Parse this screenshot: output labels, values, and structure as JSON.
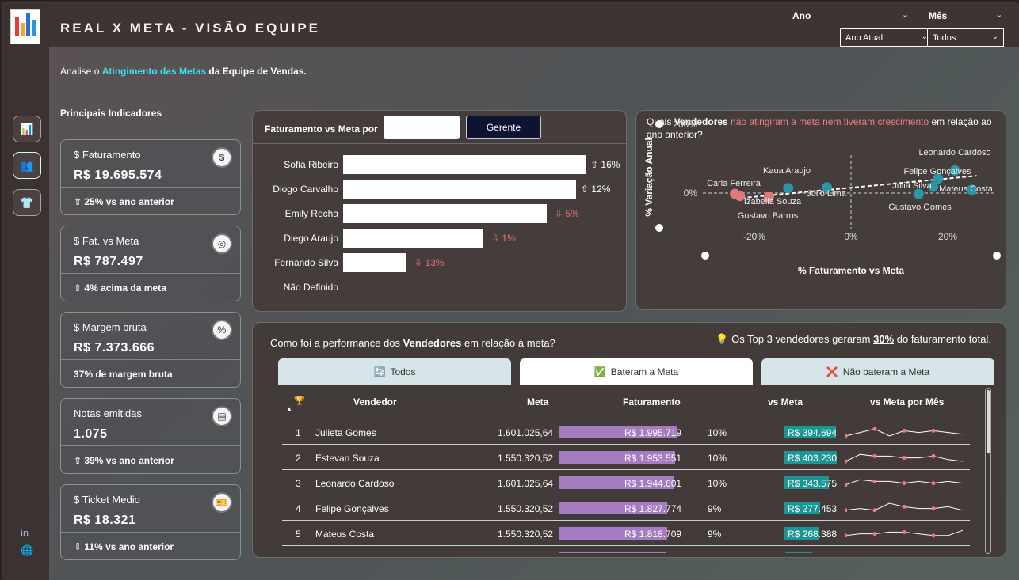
{
  "header": {
    "title": "REAL X META - VISÃO EQUIPE",
    "filters": [
      {
        "label": "Ano",
        "value": "Ano Atual"
      },
      {
        "label": "Mês",
        "value": "Todos"
      }
    ]
  },
  "intro": {
    "pre": "Analise o ",
    "highlight": "Atingimento das Metas",
    "post": " da Equipe de Vendas."
  },
  "kpi_section": {
    "title_pre": "Principais ",
    "title_bold": "Indicadores"
  },
  "kpis": [
    {
      "title": "$ Faturamento",
      "value": "R$ 19.695.574",
      "sub": "⇧ 25% vs ano anterior",
      "icon": "money-icon"
    },
    {
      "title": "$ Fat. vs Meta",
      "value": "R$ 787.497",
      "sub": "⇧ 4% acima da meta",
      "icon": "target-icon"
    },
    {
      "title": "$ Margem bruta",
      "value": "R$ 7.373.666",
      "sub": "37% de margem bruta",
      "icon": "percent-icon"
    },
    {
      "title": "Notas emitidas",
      "value": "1.075",
      "sub": "⇧ 39% vs ano anterior",
      "icon": "receipt-icon"
    },
    {
      "title": "$ Ticket Medio",
      "value": "R$ 18.321",
      "sub": "⇩ 11% vs ano anterior",
      "icon": "ticket-icon"
    }
  ],
  "bar_panel": {
    "title": "Faturamento vs Meta por",
    "toggle": "Gerente",
    "rows": [
      {
        "name": "Sofia Ribeiro",
        "value": 1.0,
        "pct": "⇧ 16%",
        "dir": "pos"
      },
      {
        "name": "Diogo Carvalho",
        "value": 0.96,
        "pct": "⇧ 12%",
        "dir": "pos"
      },
      {
        "name": "Emily Rocha",
        "value": 0.84,
        "pct": "⇩ 5%",
        "dir": "neg"
      },
      {
        "name": "Diego Araujo",
        "value": 0.58,
        "pct": "⇩ 1%",
        "dir": "neg"
      },
      {
        "name": "Fernando Silva",
        "value": 0.26,
        "pct": "⇩ 13%",
        "dir": "neg"
      },
      {
        "name": "Não Definido",
        "value": 0,
        "pct": "",
        "dir": "pos"
      }
    ]
  },
  "scatter": {
    "title_pre": "Quais ",
    "title_bold": "Vendedores",
    "title_red": " não atingiram a meta nem tiveram crescimento",
    "title_post": " em relação ao ano anterior?",
    "xlabel": "% Faturamento vs Meta",
    "ylabel": "% Variação Anual",
    "xticks": [
      {
        "v": -20,
        "t": "-20%"
      },
      {
        "v": 0,
        "t": "0%"
      },
      {
        "v": 20,
        "t": "20%"
      }
    ],
    "yticks": [
      {
        "v": 200,
        "t": "200%"
      },
      {
        "v": 0,
        "t": "0%"
      }
    ],
    "points": [
      {
        "name": "Leonardo Cardoso",
        "x": 21.5,
        "y": 55,
        "c": "#2a97a8"
      },
      {
        "name": "Felipe Gonçalves",
        "x": 18,
        "y": 35,
        "c": "#2a97a8"
      },
      {
        "name": "Kaua Araujo",
        "x": -13,
        "y": 12,
        "c": "#2a97a8"
      },
      {
        "name": "Julio Lima",
        "x": -5,
        "y": 14,
        "c": "#2a97a8"
      },
      {
        "name": "Julia Silva",
        "x": 17,
        "y": 15,
        "c": "#2a97a8"
      },
      {
        "name": "Mateus Costa",
        "x": 25,
        "y": 8,
        "c": "#2a97a8"
      },
      {
        "name": "Gustavo Gomes",
        "x": 14,
        "y": -2,
        "c": "#2a97a8"
      },
      {
        "name": "Carla Ferreira",
        "x": -24,
        "y": -2,
        "c": "#e07a7a"
      },
      {
        "name": "Izabella Souza",
        "x": -17,
        "y": -10,
        "c": "#e07a7a"
      },
      {
        "name": "Gustavo Barros",
        "x": -23,
        "y": -7,
        "c": "#e07a7a"
      }
    ]
  },
  "perf": {
    "title_pre": "Como foi a performance dos ",
    "title_bold": "Vendedores",
    "title_post": " em relação à meta?",
    "insight_pre": "💡 Os Top 3 vendedores geraram ",
    "insight_bold": "30%",
    "insight_post": " do faturamento total.",
    "tabs": [
      {
        "label": "Todos",
        "icon": "refresh-icon",
        "glyph": "🔄"
      },
      {
        "label": "Bateram a Meta",
        "icon": "check-icon",
        "glyph": "✅"
      },
      {
        "label": "Não bateram a Meta",
        "icon": "cross-icon",
        "glyph": "❌"
      }
    ],
    "columns": [
      "Vendedor",
      "Meta",
      "Faturamento",
      "vs Meta",
      "vs Meta por Mês"
    ],
    "rows": [
      {
        "rank": "1",
        "name": "Julieta Gomes",
        "meta": "1.601.025,64",
        "fat": "R$ 1.995.719",
        "fatv": 1995719,
        "pct": "10%",
        "vs": "R$ 394.694",
        "vsv": 394694
      },
      {
        "rank": "2",
        "name": "Estevan Souza",
        "meta": "1.550.320,52",
        "fat": "R$ 1.953.551",
        "fatv": 1953551,
        "pct": "10%",
        "vs": "R$ 403.230",
        "vsv": 403230
      },
      {
        "rank": "3",
        "name": "Leonardo Cardoso",
        "meta": "1.601.025,64",
        "fat": "R$ 1.944.601",
        "fatv": 1944601,
        "pct": "10%",
        "vs": "R$ 343.575",
        "vsv": 343575
      },
      {
        "rank": "4",
        "name": "Felipe Gonçalves",
        "meta": "1.550.320,52",
        "fat": "R$ 1.827.774",
        "fatv": 1827774,
        "pct": "9%",
        "vs": "R$ 277.453",
        "vsv": 277453
      },
      {
        "rank": "5",
        "name": "Mateus Costa",
        "meta": "1.550.320,52",
        "fat": "R$ 1.818.709",
        "fatv": 1818709,
        "pct": "9%",
        "vs": "R$ 268.388",
        "vsv": 268388
      }
    ]
  }
}
